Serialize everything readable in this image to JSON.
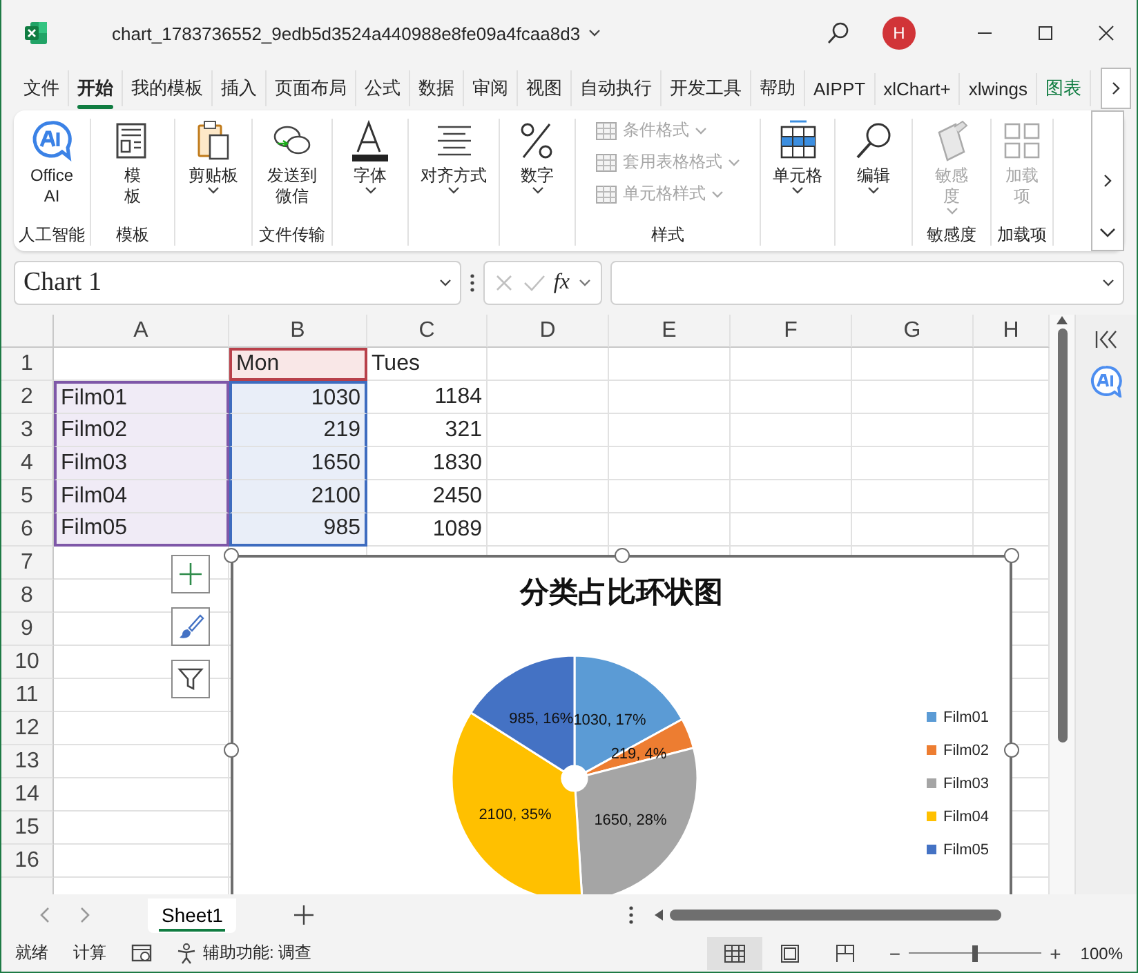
{
  "window": {
    "title": "chart_1783736552_9edb5d3524a440988e8fe09a4fcaa8d3",
    "avatar": "H"
  },
  "menu_tabs": [
    {
      "label": "文件",
      "selected": false,
      "color": "#262626"
    },
    {
      "label": "开始",
      "selected": true,
      "color": "#262626"
    },
    {
      "label": "我的模板",
      "selected": false,
      "color": "#262626"
    },
    {
      "label": "插入",
      "selected": false,
      "color": "#262626"
    },
    {
      "label": "页面布局",
      "selected": false,
      "color": "#262626"
    },
    {
      "label": "公式",
      "selected": false,
      "color": "#262626"
    },
    {
      "label": "数据",
      "selected": false,
      "color": "#262626"
    },
    {
      "label": "审阅",
      "selected": false,
      "color": "#262626"
    },
    {
      "label": "视图",
      "selected": false,
      "color": "#262626"
    },
    {
      "label": "自动执行",
      "selected": false,
      "color": "#262626"
    },
    {
      "label": "开发工具",
      "selected": false,
      "color": "#262626"
    },
    {
      "label": "帮助",
      "selected": false,
      "color": "#262626"
    },
    {
      "label": "AIPPT",
      "selected": false,
      "color": "#262626"
    },
    {
      "label": "xlChart+",
      "selected": false,
      "color": "#262626"
    },
    {
      "label": "xlwings",
      "selected": false,
      "color": "#262626"
    },
    {
      "label": "图表",
      "selected": false,
      "color": "#107c41"
    }
  ],
  "ribbon": {
    "groups": [
      {
        "label": "人工智能",
        "items": [
          {
            "kind": "large",
            "label": "Office\nAI",
            "dropdown": false,
            "disabled": false
          }
        ]
      },
      {
        "label": "模板",
        "items": [
          {
            "kind": "large",
            "label": "模板",
            "dropdown": false,
            "disabled": false
          }
        ]
      },
      {
        "items": [
          {
            "kind": "large",
            "label": "剪贴板",
            "dropdown": true,
            "disabled": false
          }
        ]
      },
      {
        "label": "文件传输",
        "items": [
          {
            "kind": "large",
            "label": "发送到微信",
            "dropdown": false,
            "disabled": false
          }
        ]
      },
      {
        "items": [
          {
            "kind": "large",
            "label": "字体",
            "dropdown": true,
            "disabled": false
          }
        ]
      },
      {
        "items": [
          {
            "kind": "large",
            "label": "对齐方式",
            "dropdown": true,
            "disabled": false
          }
        ]
      },
      {
        "items": [
          {
            "kind": "large",
            "label": "数字",
            "dropdown": true,
            "disabled": false
          }
        ]
      },
      {
        "label": "样式",
        "items": [
          {
            "kind": "small",
            "label": "条件格式",
            "dropdown": true,
            "disabled": true
          },
          {
            "kind": "small",
            "label": "套用表格格式",
            "dropdown": true,
            "disabled": true
          },
          {
            "kind": "small",
            "label": "单元格样式",
            "dropdown": true,
            "disabled": true
          }
        ]
      },
      {
        "items": [
          {
            "kind": "large",
            "label": "单元格",
            "dropdown": true,
            "disabled": false
          }
        ]
      },
      {
        "items": [
          {
            "kind": "large",
            "label": "编辑",
            "dropdown": true,
            "disabled": false
          }
        ]
      },
      {
        "label": "敏感度",
        "items": [
          {
            "kind": "large",
            "label": "敏感度",
            "dropdown": true,
            "disabled": true
          }
        ]
      },
      {
        "label": "加载项",
        "items": [
          {
            "kind": "large",
            "label": "加载项",
            "dropdown": false,
            "disabled": true
          }
        ]
      }
    ]
  },
  "formula_bar": {
    "name_box": "Chart 1",
    "function_label": "fx"
  },
  "sheet": {
    "columns": [
      "A",
      "B",
      "C",
      "D",
      "E",
      "F",
      "G",
      "H"
    ],
    "rows": [
      {
        "header": "1",
        "cells": [
          null,
          {
            "text": "Mon",
            "kind": "name"
          },
          {
            "text": "Tues",
            "kind": "plain"
          }
        ]
      },
      {
        "header": "2",
        "cells": [
          {
            "text": "Film01",
            "kind": "category"
          },
          {
            "text": "1030",
            "kind": "value"
          },
          {
            "text": "1184",
            "kind": "plain"
          }
        ]
      },
      {
        "header": "3",
        "cells": [
          {
            "text": "Film02",
            "kind": "category"
          },
          {
            "text": "219",
            "kind": "value"
          },
          {
            "text": "321",
            "kind": "plain"
          }
        ]
      },
      {
        "header": "4",
        "cells": [
          {
            "text": "Film03",
            "kind": "category"
          },
          {
            "text": "1650",
            "kind": "value"
          },
          {
            "text": "1830",
            "kind": "plain"
          }
        ]
      },
      {
        "header": "5",
        "cells": [
          {
            "text": "Film04",
            "kind": "category"
          },
          {
            "text": "2100",
            "kind": "value"
          },
          {
            "text": "2450",
            "kind": "plain"
          }
        ]
      },
      {
        "header": "6",
        "cells": [
          {
            "text": "Film05",
            "kind": "category"
          },
          {
            "text": "985",
            "kind": "value"
          },
          {
            "text": "1089",
            "kind": "plain"
          }
        ]
      },
      {
        "header": "7"
      },
      {
        "header": "8"
      },
      {
        "header": "9"
      },
      {
        "header": "10"
      },
      {
        "header": "11"
      },
      {
        "header": "12"
      },
      {
        "header": "13"
      },
      {
        "header": "14"
      },
      {
        "header": "15"
      },
      {
        "header": "16"
      }
    ]
  },
  "chart": {
    "chart_data": {
      "type": "pie",
      "legend": true,
      "title": "分类占比环状图",
      "categories": [
        "Film01",
        "Film02",
        "Film03",
        "Film04",
        "Film05"
      ],
      "series": [
        {
          "values": [
            17,
            4,
            28,
            35,
            16
          ]
        }
      ],
      "colors": [
        "#5b9bd5",
        "#ed7d31",
        "#a5a5a5",
        "#ffc000",
        "#4472c4"
      ],
      "value_labels": [
        "1030, 17%",
        "219, 4%",
        "1650, 28%",
        "2100, 35%",
        "985, 16%"
      ]
    }
  },
  "sheet_tabs": [
    {
      "label": "Sheet1",
      "selected": true
    }
  ],
  "status_bar": {
    "ready": "就绪",
    "calculate": "计算",
    "accessibility": "辅助功能: 调查",
    "views": [
      {
        "selected": true
      },
      {
        "selected": false
      },
      {
        "selected": false
      }
    ],
    "zoom_out": "−",
    "zoom_slider": {
      "level": 0.5
    },
    "zoom_in": "+",
    "zoom": "100%"
  }
}
